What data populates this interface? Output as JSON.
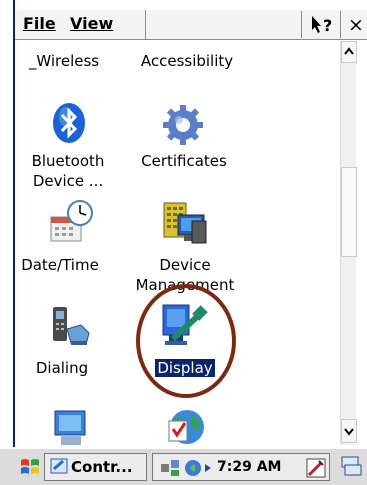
{
  "menu": {
    "file": "File",
    "view": "View"
  },
  "controls": {
    "help_glyph": "?",
    "close_glyph": "×"
  },
  "items": [
    {
      "label": "_Wireless"
    },
    {
      "label": "Accessibility"
    },
    {
      "label_line1": "Bluetooth",
      "label_line2": "Device ..."
    },
    {
      "label": "Certificates"
    },
    {
      "label": "Date/Time"
    },
    {
      "label_line1": "Device",
      "label_line2": "Management"
    },
    {
      "label": "Dialing"
    },
    {
      "label": "Display"
    }
  ],
  "taskbar": {
    "task_label": "Contr...",
    "time": "7:29 AM"
  },
  "colors": {
    "selection": "#0a246a",
    "annotation_ellipse": "#7a2a12"
  }
}
